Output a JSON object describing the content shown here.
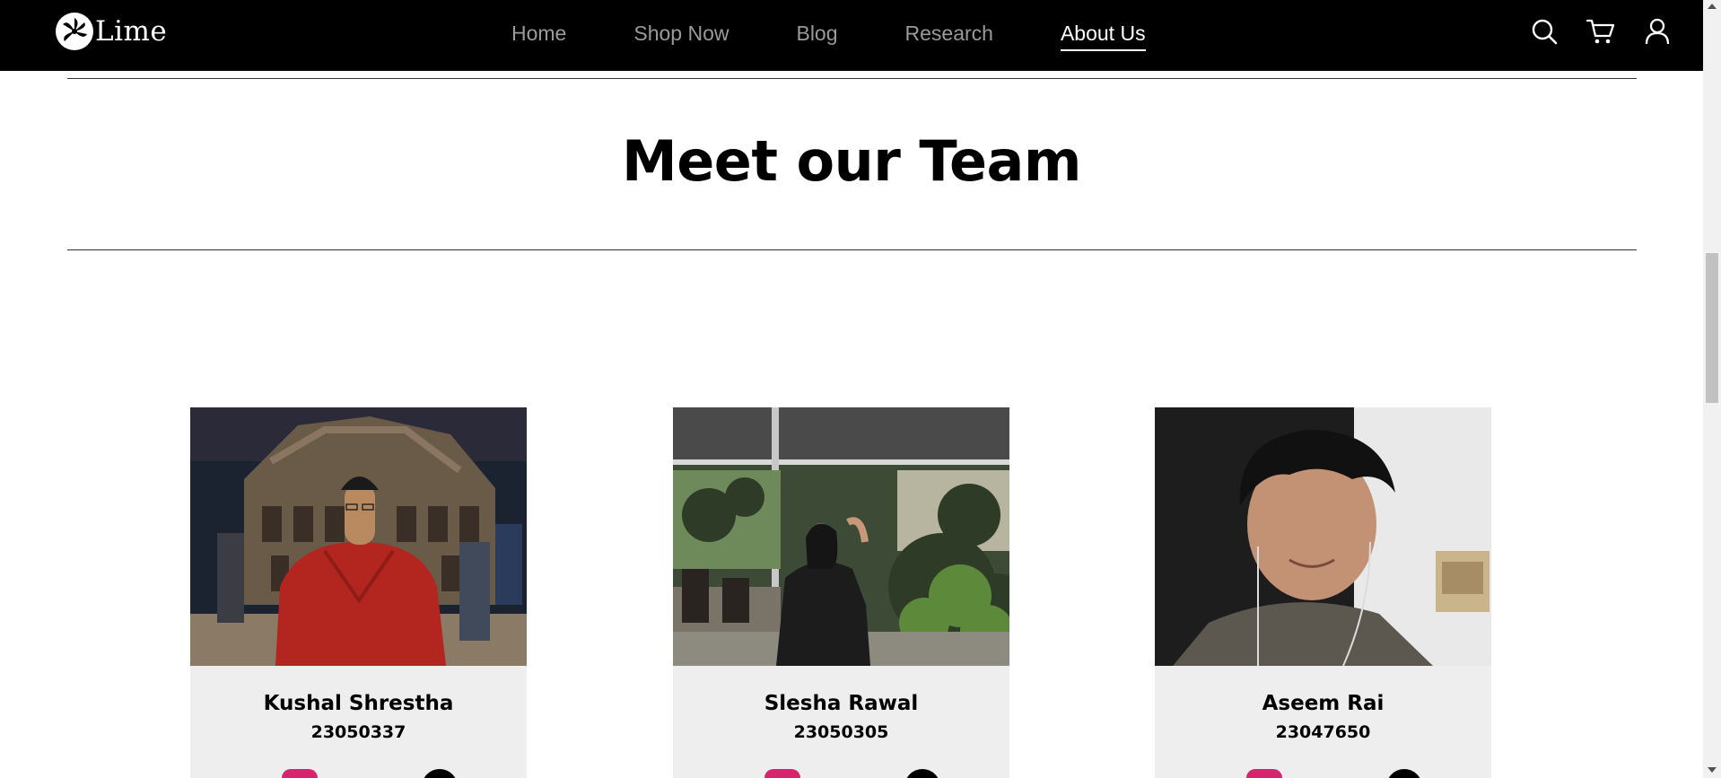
{
  "brand": {
    "name": "Lime"
  },
  "nav": {
    "links": [
      {
        "label": "Home",
        "active": false
      },
      {
        "label": "Shop Now",
        "active": false
      },
      {
        "label": "Blog",
        "active": false
      },
      {
        "label": "Research",
        "active": false
      },
      {
        "label": "About Us",
        "active": true
      }
    ],
    "icons": [
      "search-icon",
      "cart-icon",
      "user-icon"
    ]
  },
  "section": {
    "title": "Meet our Team"
  },
  "team": [
    {
      "name": "Kushal Shrestha",
      "id": "23050337",
      "socials": [
        "instagram-icon",
        "github-icon"
      ]
    },
    {
      "name": "Slesha Rawal",
      "id": "23050305",
      "socials": [
        "instagram-icon",
        "github-icon"
      ]
    },
    {
      "name": "Aseem Rai",
      "id": "23047650",
      "socials": [
        "instagram-icon",
        "github-icon"
      ]
    }
  ],
  "colors": {
    "navbar_bg": "#000000",
    "nav_inactive": "#9a9a9a",
    "nav_active": "#ffffff",
    "card_bg": "#eeeeee",
    "instagram": "#d6246e"
  }
}
